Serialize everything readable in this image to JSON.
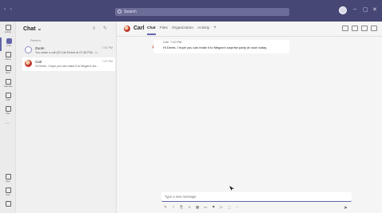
{
  "titlebar": {
    "nav": "‹ ›",
    "search_placeholder": "Search",
    "controls": [
      "–",
      "▢",
      "✕"
    ]
  },
  "appbar": {
    "items": [
      {
        "label": "Activity",
        "icon": "bell-icon"
      },
      {
        "label": "Chat",
        "icon": "chat-icon"
      },
      {
        "label": "Teams",
        "icon": "teams-icon"
      },
      {
        "label": "Meet",
        "icon": "video-icon"
      },
      {
        "label": "Calendar",
        "icon": "calendar-icon"
      },
      {
        "label": "Calls",
        "icon": "phone-icon"
      },
      {
        "label": "Files",
        "icon": "file-icon"
      }
    ],
    "bottom_items": [
      {
        "label": "Apps",
        "icon": "apps-icon"
      },
      {
        "label": "Help",
        "icon": "help-icon"
      },
      {
        "label": "",
        "icon": "device-icon"
      }
    ],
    "more": "···"
  },
  "chatlist": {
    "title": "Chat ⌄",
    "filter": "⚲",
    "new_chat": "✎",
    "section": "Recent",
    "items": [
      {
        "name": "Zoom",
        "time": "7:51 PM",
        "preview": "You made a call (53 Call Ended at 07:48 PM) · 1..."
      },
      {
        "name": "Carl",
        "time": "7:10 PM",
        "preview": "Hi Derek. I hope you can make it to Megan's sur..."
      }
    ]
  },
  "main": {
    "contact_name": "Carl",
    "tabs": [
      "Chat",
      "Files",
      "Organization",
      "Activity"
    ],
    "tab_add": "+",
    "message": {
      "sender": "Carl",
      "time": "7:10 PM",
      "text": "Hi Derek. I hope you can make it to Megan's surprise party at noon today."
    },
    "compose_placeholder": "Type a new message",
    "toolbar": [
      "✎",
      "!",
      "⎘",
      "☺",
      "▦",
      "▭",
      "⚑",
      "▷",
      "⬚",
      "···"
    ],
    "send": "➤"
  },
  "colors": {
    "titlebar": "#464775",
    "accent": "#6264a7"
  }
}
